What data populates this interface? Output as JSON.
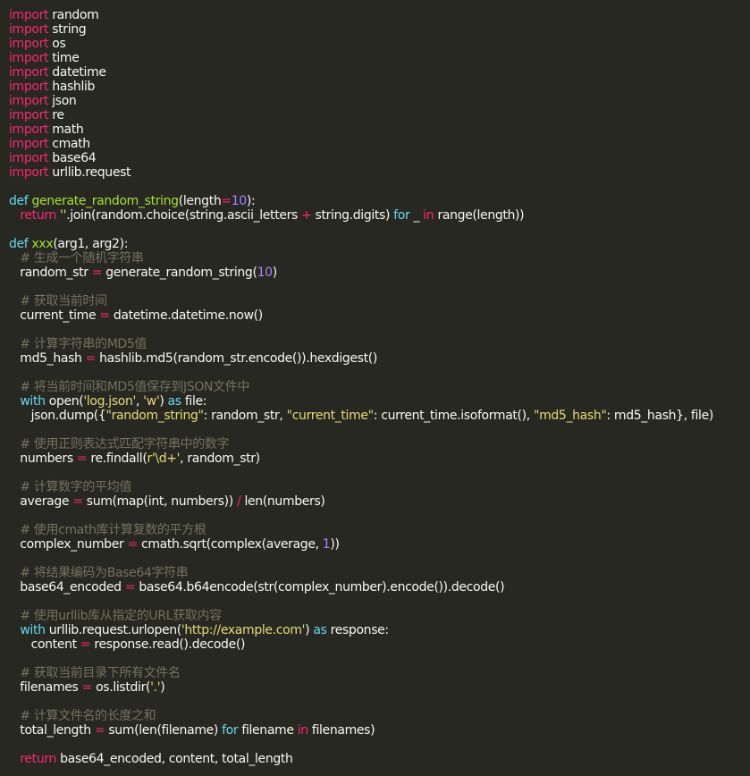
{
  "editor": {
    "language": "python",
    "colors": {
      "background": "#272822",
      "text": "#f8f8f2",
      "keyword": "#f92672",
      "definition": "#66d9ef",
      "function": "#a6e22e",
      "number": "#ae81ff",
      "string": "#e6db74",
      "comment": "#75715e"
    },
    "lines": [
      [
        {
          "t": "kw",
          "v": "import"
        },
        {
          "t": "tx",
          "v": " random"
        }
      ],
      [
        {
          "t": "kw",
          "v": "import"
        },
        {
          "t": "tx",
          "v": " string"
        }
      ],
      [
        {
          "t": "kw",
          "v": "import"
        },
        {
          "t": "tx",
          "v": " os"
        }
      ],
      [
        {
          "t": "kw",
          "v": "import"
        },
        {
          "t": "tx",
          "v": " time"
        }
      ],
      [
        {
          "t": "kw",
          "v": "import"
        },
        {
          "t": "tx",
          "v": " datetime"
        }
      ],
      [
        {
          "t": "kw",
          "v": "import"
        },
        {
          "t": "tx",
          "v": " hashlib"
        }
      ],
      [
        {
          "t": "kw",
          "v": "import"
        },
        {
          "t": "tx",
          "v": " json"
        }
      ],
      [
        {
          "t": "kw",
          "v": "import"
        },
        {
          "t": "tx",
          "v": " re"
        }
      ],
      [
        {
          "t": "kw",
          "v": "import"
        },
        {
          "t": "tx",
          "v": " math"
        }
      ],
      [
        {
          "t": "kw",
          "v": "import"
        },
        {
          "t": "tx",
          "v": " cmath"
        }
      ],
      [
        {
          "t": "kw",
          "v": "import"
        },
        {
          "t": "tx",
          "v": " base64"
        }
      ],
      [
        {
          "t": "kw",
          "v": "import"
        },
        {
          "t": "tx",
          "v": " urllib.request"
        }
      ],
      [],
      [
        {
          "t": "def",
          "v": "def"
        },
        {
          "t": "tx",
          "v": " "
        },
        {
          "t": "fn",
          "v": "generate_random_string"
        },
        {
          "t": "tx",
          "v": "(length"
        },
        {
          "t": "op",
          "v": "="
        },
        {
          "t": "num",
          "v": "10"
        },
        {
          "t": "tx",
          "v": "):"
        }
      ],
      [
        {
          "t": "tx",
          "v": "   "
        },
        {
          "t": "kw",
          "v": "return"
        },
        {
          "t": "tx",
          "v": " "
        },
        {
          "t": "str",
          "v": "''"
        },
        {
          "t": "tx",
          "v": ".join(random.choice(string.ascii_letters "
        },
        {
          "t": "op",
          "v": "+"
        },
        {
          "t": "tx",
          "v": " string.digits) "
        },
        {
          "t": "def",
          "v": "for"
        },
        {
          "t": "tx",
          "v": " _ "
        },
        {
          "t": "kw",
          "v": "in"
        },
        {
          "t": "tx",
          "v": " range(length))"
        }
      ],
      [],
      [
        {
          "t": "def",
          "v": "def"
        },
        {
          "t": "tx",
          "v": " "
        },
        {
          "t": "fn",
          "v": "xxx"
        },
        {
          "t": "tx",
          "v": "(arg1, arg2):"
        }
      ],
      [
        {
          "t": "tx",
          "v": "   "
        },
        {
          "t": "com",
          "v": "# 生成一个随机字符串"
        }
      ],
      [
        {
          "t": "tx",
          "v": "   random_str "
        },
        {
          "t": "op",
          "v": "="
        },
        {
          "t": "tx",
          "v": " generate_random_string("
        },
        {
          "t": "num",
          "v": "10"
        },
        {
          "t": "tx",
          "v": ")"
        }
      ],
      [],
      [
        {
          "t": "tx",
          "v": "   "
        },
        {
          "t": "com",
          "v": "# 获取当前时间"
        }
      ],
      [
        {
          "t": "tx",
          "v": "   current_time "
        },
        {
          "t": "op",
          "v": "="
        },
        {
          "t": "tx",
          "v": " datetime.datetime.now()"
        }
      ],
      [],
      [
        {
          "t": "tx",
          "v": "   "
        },
        {
          "t": "com",
          "v": "# 计算字符串的MD5值"
        }
      ],
      [
        {
          "t": "tx",
          "v": "   md5_hash "
        },
        {
          "t": "op",
          "v": "="
        },
        {
          "t": "tx",
          "v": " hashlib.md5(random_str.encode()).hexdigest()"
        }
      ],
      [],
      [
        {
          "t": "tx",
          "v": "   "
        },
        {
          "t": "com",
          "v": "# 将当前时间和MD5值保存到JSON文件中"
        }
      ],
      [
        {
          "t": "tx",
          "v": "   "
        },
        {
          "t": "def",
          "v": "with"
        },
        {
          "t": "tx",
          "v": " open("
        },
        {
          "t": "str",
          "v": "'log.json'"
        },
        {
          "t": "tx",
          "v": ", "
        },
        {
          "t": "str",
          "v": "'w'"
        },
        {
          "t": "tx",
          "v": ") "
        },
        {
          "t": "def",
          "v": "as"
        },
        {
          "t": "tx",
          "v": " file:"
        }
      ],
      [
        {
          "t": "tx",
          "v": "      json.dump({"
        },
        {
          "t": "str",
          "v": "\"random_string\""
        },
        {
          "t": "tx",
          "v": ": random_str, "
        },
        {
          "t": "str",
          "v": "\"current_time\""
        },
        {
          "t": "tx",
          "v": ": current_time.isoformat(), "
        },
        {
          "t": "str",
          "v": "\"md5_hash\""
        },
        {
          "t": "tx",
          "v": ": md5_hash}, file)"
        }
      ],
      [],
      [
        {
          "t": "tx",
          "v": "   "
        },
        {
          "t": "com",
          "v": "# 使用正则表达式匹配字符串中的数字"
        }
      ],
      [
        {
          "t": "tx",
          "v": "   numbers "
        },
        {
          "t": "op",
          "v": "="
        },
        {
          "t": "tx",
          "v": " re.findall("
        },
        {
          "t": "str",
          "v": "r'\\d+'"
        },
        {
          "t": "tx",
          "v": ", random_str)"
        }
      ],
      [],
      [
        {
          "t": "tx",
          "v": "   "
        },
        {
          "t": "com",
          "v": "# 计算数字的平均值"
        }
      ],
      [
        {
          "t": "tx",
          "v": "   average "
        },
        {
          "t": "op",
          "v": "="
        },
        {
          "t": "tx",
          "v": " sum(map(int, numbers)) "
        },
        {
          "t": "op",
          "v": "/"
        },
        {
          "t": "tx",
          "v": " len(numbers)"
        }
      ],
      [],
      [
        {
          "t": "tx",
          "v": "   "
        },
        {
          "t": "com",
          "v": "# 使用cmath库计算复数的平方根"
        }
      ],
      [
        {
          "t": "tx",
          "v": "   complex_number "
        },
        {
          "t": "op",
          "v": "="
        },
        {
          "t": "tx",
          "v": " cmath.sqrt(complex(average, "
        },
        {
          "t": "num",
          "v": "1"
        },
        {
          "t": "tx",
          "v": "))"
        }
      ],
      [],
      [
        {
          "t": "tx",
          "v": "   "
        },
        {
          "t": "com",
          "v": "# 将结果编码为Base64字符串"
        }
      ],
      [
        {
          "t": "tx",
          "v": "   base64_encoded "
        },
        {
          "t": "op",
          "v": "="
        },
        {
          "t": "tx",
          "v": " base64.b64encode(str(complex_number).encode()).decode()"
        }
      ],
      [],
      [
        {
          "t": "tx",
          "v": "   "
        },
        {
          "t": "com",
          "v": "# 使用urllib库从指定的URL获取内容"
        }
      ],
      [
        {
          "t": "tx",
          "v": "   "
        },
        {
          "t": "def",
          "v": "with"
        },
        {
          "t": "tx",
          "v": " urllib.request.urlopen("
        },
        {
          "t": "str",
          "v": "'http://example.com'"
        },
        {
          "t": "tx",
          "v": ") "
        },
        {
          "t": "def",
          "v": "as"
        },
        {
          "t": "tx",
          "v": " response:"
        }
      ],
      [
        {
          "t": "tx",
          "v": "      content "
        },
        {
          "t": "op",
          "v": "="
        },
        {
          "t": "tx",
          "v": " response.read().decode()"
        }
      ],
      [],
      [
        {
          "t": "tx",
          "v": "   "
        },
        {
          "t": "com",
          "v": "# 获取当前目录下所有文件名"
        }
      ],
      [
        {
          "t": "tx",
          "v": "   filenames "
        },
        {
          "t": "op",
          "v": "="
        },
        {
          "t": "tx",
          "v": " os.listdir("
        },
        {
          "t": "str",
          "v": "'.'"
        },
        {
          "t": "tx",
          "v": ")"
        }
      ],
      [],
      [
        {
          "t": "tx",
          "v": "   "
        },
        {
          "t": "com",
          "v": "# 计算文件名的长度之和"
        }
      ],
      [
        {
          "t": "tx",
          "v": "   total_length "
        },
        {
          "t": "op",
          "v": "="
        },
        {
          "t": "tx",
          "v": " sum(len(filename) "
        },
        {
          "t": "def",
          "v": "for"
        },
        {
          "t": "tx",
          "v": " filename "
        },
        {
          "t": "kw",
          "v": "in"
        },
        {
          "t": "tx",
          "v": " filenames)"
        }
      ],
      [],
      [
        {
          "t": "tx",
          "v": "   "
        },
        {
          "t": "kw",
          "v": "return"
        },
        {
          "t": "tx",
          "v": " base64_encoded, content, total_length"
        }
      ]
    ]
  }
}
